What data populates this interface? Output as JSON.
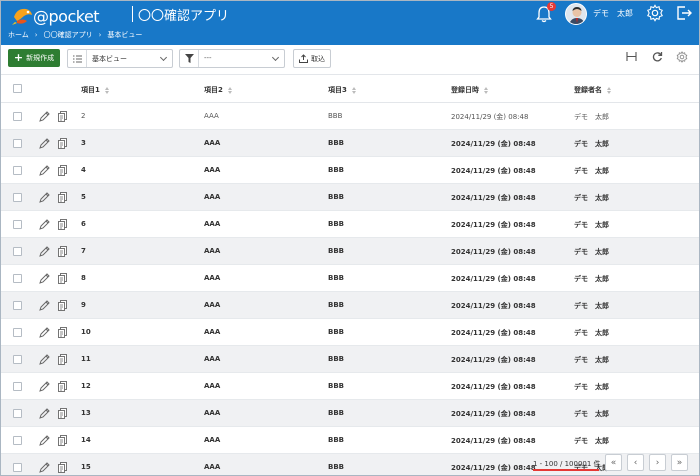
{
  "header": {
    "logo_text": "@pocket",
    "app_title": "〇〇確認アプリ",
    "breadcrumb": [
      "ホーム",
      "〇〇確認アプリ",
      "基本ビュー"
    ],
    "notification_count": "5",
    "user_name": "デモ　太郎",
    "colors": {
      "bar": "#1878c8",
      "badge": "#e53935"
    }
  },
  "toolbar": {
    "new_label": "新規作成",
    "view_value": "基本ビュー",
    "filter_value": "---",
    "import_label": "取込",
    "right_icons": [
      "height-icon",
      "refresh-icon",
      "settings-icon"
    ],
    "new_color": "#2e7d32"
  },
  "table": {
    "columns": [
      "項目1",
      "項目2",
      "項目3",
      "登録日時",
      "登録者名"
    ],
    "rows": [
      {
        "c1": "2",
        "c2": "AAA",
        "c3": "BBB",
        "date": "2024/11/29 (金) 08:48",
        "user": "デモ　太郎"
      },
      {
        "c1": "3",
        "c2": "AAA",
        "c3": "BBB",
        "date": "2024/11/29 (金) 08:48",
        "user": "デモ　太郎"
      },
      {
        "c1": "4",
        "c2": "AAA",
        "c3": "BBB",
        "date": "2024/11/29 (金) 08:48",
        "user": "デモ　太郎"
      },
      {
        "c1": "5",
        "c2": "AAA",
        "c3": "BBB",
        "date": "2024/11/29 (金) 08:48",
        "user": "デモ　太郎"
      },
      {
        "c1": "6",
        "c2": "AAA",
        "c3": "BBB",
        "date": "2024/11/29 (金) 08:48",
        "user": "デモ　太郎"
      },
      {
        "c1": "7",
        "c2": "AAA",
        "c3": "BBB",
        "date": "2024/11/29 (金) 08:48",
        "user": "デモ　太郎"
      },
      {
        "c1": "8",
        "c2": "AAA",
        "c3": "BBB",
        "date": "2024/11/29 (金) 08:48",
        "user": "デモ　太郎"
      },
      {
        "c1": "9",
        "c2": "AAA",
        "c3": "BBB",
        "date": "2024/11/29 (金) 08:48",
        "user": "デモ　太郎"
      },
      {
        "c1": "10",
        "c2": "AAA",
        "c3": "BBB",
        "date": "2024/11/29 (金) 08:48",
        "user": "デモ　太郎"
      },
      {
        "c1": "11",
        "c2": "AAA",
        "c3": "BBB",
        "date": "2024/11/29 (金) 08:48",
        "user": "デモ　太郎"
      },
      {
        "c1": "12",
        "c2": "AAA",
        "c3": "BBB",
        "date": "2024/11/29 (金) 08:48",
        "user": "デモ　太郎"
      },
      {
        "c1": "13",
        "c2": "AAA",
        "c3": "BBB",
        "date": "2024/11/29 (金) 08:48",
        "user": "デモ　太郎"
      },
      {
        "c1": "14",
        "c2": "AAA",
        "c3": "BBB",
        "date": "2024/11/29 (金) 08:48",
        "user": "デモ　太郎"
      },
      {
        "c1": "15",
        "c2": "AAA",
        "c3": "BBB",
        "date": "2024/11/29 (金) 08:48",
        "user": "デモ　太郎"
      }
    ]
  },
  "pagination": {
    "info": "1 - 100 / 100001 件",
    "buttons": [
      "first-page-icon",
      "prev-page-icon",
      "next-page-icon",
      "last-page-icon"
    ]
  }
}
